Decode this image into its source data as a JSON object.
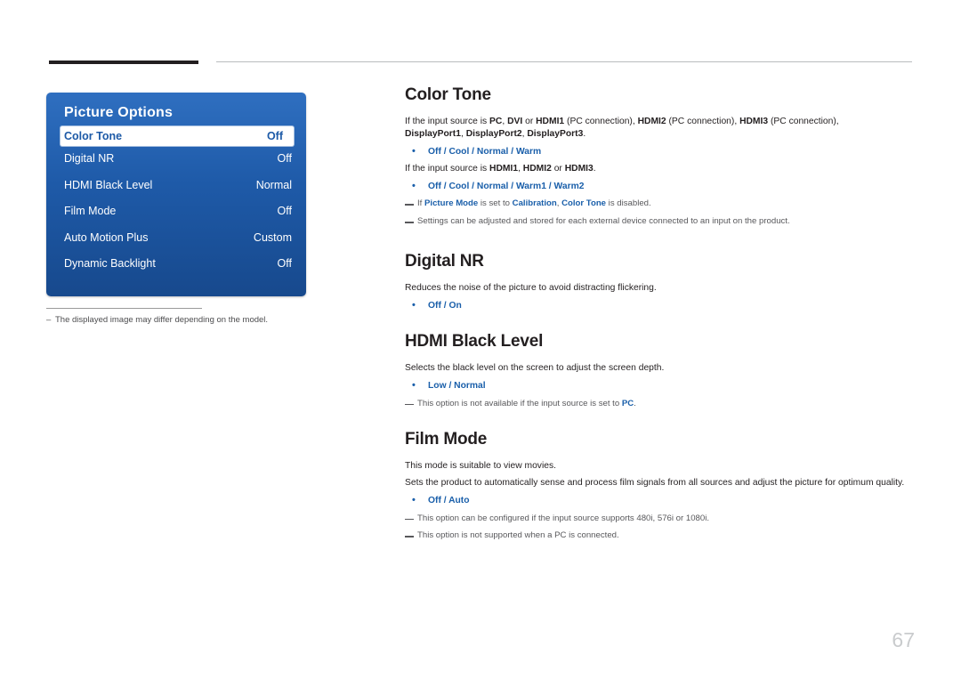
{
  "menu": {
    "title": "Picture Options",
    "rows": [
      {
        "label": "Color Tone",
        "value": "Off",
        "selected": true
      },
      {
        "label": "Digital NR",
        "value": "Off",
        "selected": false
      },
      {
        "label": "HDMI Black Level",
        "value": "Normal",
        "selected": false
      },
      {
        "label": "Film Mode",
        "value": "Off",
        "selected": false
      },
      {
        "label": "Auto Motion Plus",
        "value": "Custom",
        "selected": false
      },
      {
        "label": "Dynamic Backlight",
        "value": "Off",
        "selected": false
      }
    ],
    "note": "The displayed image may differ depending on the model."
  },
  "sections": {
    "color_tone": {
      "heading": "Color Tone",
      "line1_a": "If the input source is ",
      "line1_pc": "PC",
      "line1_sep1": ", ",
      "line1_dvi": "DVI",
      "line1_or": " or ",
      "line1_hdmi1": "HDMI1",
      "line1_paren1": " (PC connection), ",
      "line1_hdmi2": "HDMI2",
      "line1_paren2": " (PC connection), ",
      "line1_hdmi3": "HDMI3",
      "line1_paren3": " (PC connection), ",
      "line1_dp1": "DisplayPort1",
      "line1_dp2": "DisplayPort2",
      "line1_dp3": "DisplayPort3",
      "line1_end": ".",
      "bullet1": "Off / Cool / Normal / Warm",
      "line2_a": "If the input source is ",
      "line2_hdmi1": "HDMI1",
      "line2_hdmi2": "HDMI2",
      "line2_or": " or ",
      "line2_hdmi3": "HDMI3",
      "line2_end": ".",
      "bullet2": "Off / Cool / Normal / Warm1 / Warm2",
      "note1_a": "If ",
      "note1_picture_mode": "Picture Mode",
      "note1_b": " is set to ",
      "note1_calibration": "Calibration",
      "note1_c": ", ",
      "note1_color_tone": "Color Tone",
      "note1_d": " is disabled.",
      "note2": "Settings can be adjusted and stored for each external device connected to an input on the product."
    },
    "digital_nr": {
      "heading": "Digital NR",
      "para": "Reduces the noise of the picture to avoid distracting flickering.",
      "bullet": "Off / On"
    },
    "hdmi_black_level": {
      "heading": "HDMI Black Level",
      "para": "Selects the black level on the screen to adjust the screen depth.",
      "bullet": "Low / Normal",
      "note_a": "This option is not available if the input source is set to ",
      "note_pc": "PC",
      "note_b": "."
    },
    "film_mode": {
      "heading": "Film Mode",
      "para1": "This mode is suitable to view movies.",
      "para2": "Sets the product to automatically sense and process film signals from all sources and adjust the picture for optimum quality.",
      "bullet": "Off / Auto",
      "note1": "This option can be configured if the input source supports 480i, 576i or 1080i.",
      "note2": "This option is not supported when a PC is connected."
    }
  },
  "page_number": "67"
}
